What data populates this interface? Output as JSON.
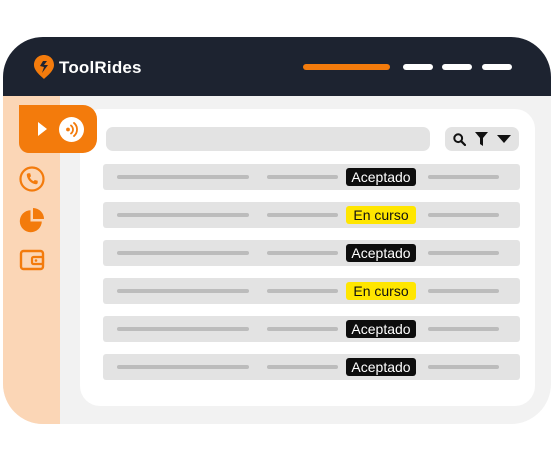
{
  "app": {
    "name": "ToolRides"
  },
  "colors": {
    "brand_orange": "#f37b0c",
    "topbar_bg": "#1d2330",
    "sidebar_bg": "#fbd6b6",
    "accepted_bg": "#0d0d0d",
    "in_progress_bg": "#ffe600"
  },
  "header": {
    "nav_items": [
      {
        "icon": "nav-bar-active",
        "active": true
      },
      {
        "icon": "nav-bar",
        "active": false
      },
      {
        "icon": "nav-bar",
        "active": false
      },
      {
        "icon": "nav-bar",
        "active": false
      }
    ]
  },
  "sidebar": {
    "items": [
      {
        "icon": "live-tracking-icon",
        "active": true
      },
      {
        "icon": "phone-icon",
        "active": false
      },
      {
        "icon": "pie-chart-icon",
        "active": false
      },
      {
        "icon": "wallet-icon",
        "active": false
      }
    ]
  },
  "toolbar": {
    "search_placeholder": "",
    "icons": [
      "search-icon",
      "filter-icon",
      "chevron-down-icon"
    ]
  },
  "rides": [
    {
      "status": "Aceptado",
      "kind": "accepted"
    },
    {
      "status": "En curso",
      "kind": "progress"
    },
    {
      "status": "Aceptado",
      "kind": "accepted"
    },
    {
      "status": "En curso",
      "kind": "progress"
    },
    {
      "status": "Aceptado",
      "kind": "accepted"
    },
    {
      "status": "Aceptado",
      "kind": "accepted"
    }
  ]
}
